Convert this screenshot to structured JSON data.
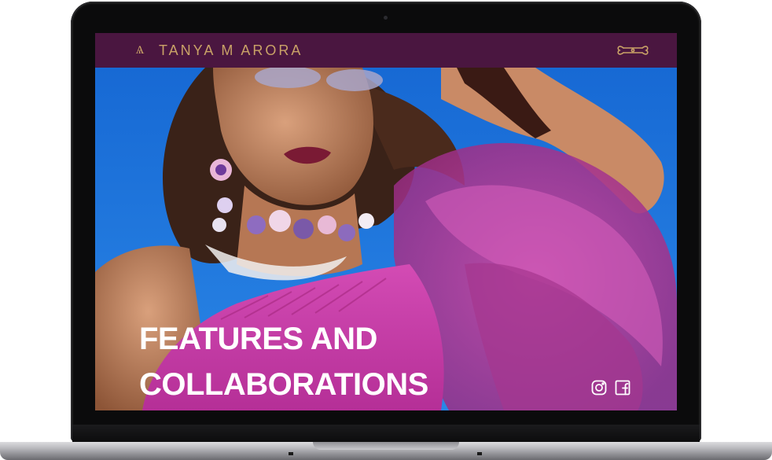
{
  "site": {
    "brand": "TANYA M ARORA",
    "logo_icon": "monogram-logo-icon",
    "menu_icon": "ornate-menu-icon"
  },
  "hero": {
    "title_line1": "FEATURES AND",
    "title_line2": "COLLABORATIONS",
    "image_icon": "fashion-portrait-image"
  },
  "social": {
    "items": [
      {
        "icon": "instagram-icon"
      },
      {
        "icon": "facebook-icon"
      }
    ]
  },
  "colors": {
    "header_bg": "#4a1640",
    "brand_gold": "#c9a267",
    "sky_blue": "#1f78d9",
    "dress_magenta": "#c23aa3",
    "title_white": "#ffffff"
  }
}
